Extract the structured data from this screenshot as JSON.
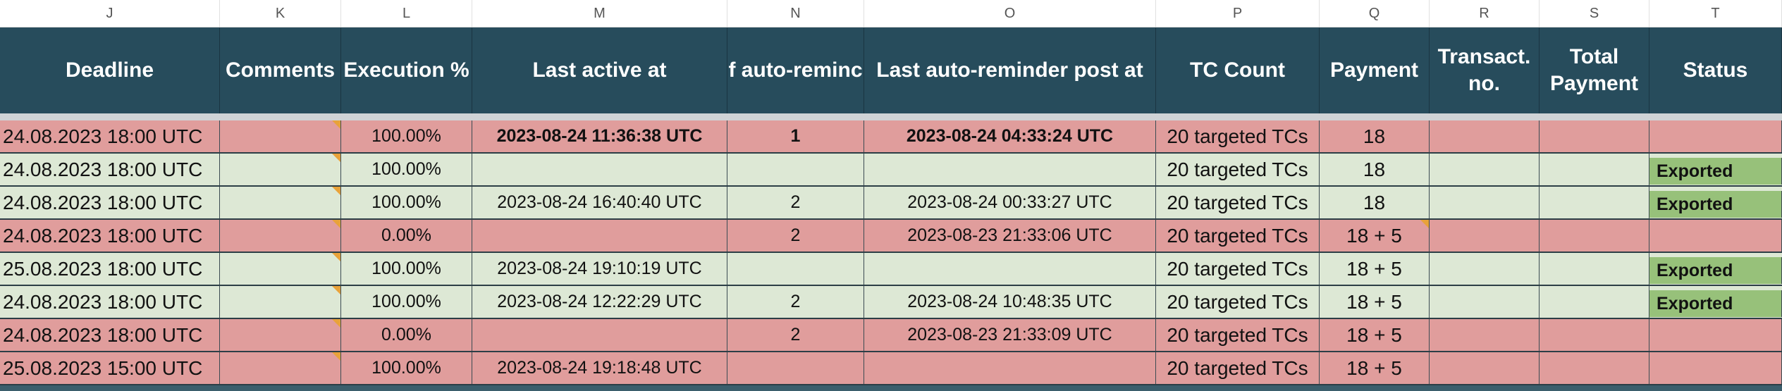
{
  "column_letters": [
    "J",
    "K",
    "L",
    "M",
    "N",
    "O",
    "P",
    "Q",
    "R",
    "S",
    "T"
  ],
  "headers": [
    "Deadline",
    "Comments",
    "Execution %",
    "Last active at",
    "f auto-reminc",
    "Last auto-reminder post at",
    "TC Count",
    "Payment",
    "Transact. no.",
    "Total Payment",
    "Status"
  ],
  "rows": [
    {
      "color": "red",
      "deadline": "24.08.2023 18:00 UTC",
      "comments": "",
      "execution": "100.00%",
      "last_active": "2023-08-24 11:36:38 UTC",
      "reminders": "1",
      "last_reminder": "2023-08-24 04:33:24 UTC",
      "tc_count": "20 targeted TCs",
      "payment": "18",
      "transact_no": "",
      "total_payment": "",
      "status": ""
    },
    {
      "color": "green",
      "deadline": "24.08.2023 18:00 UTC",
      "comments": "",
      "execution": "100.00%",
      "last_active": "",
      "reminders": "",
      "last_reminder": "",
      "tc_count": "20 targeted TCs",
      "payment": "18",
      "transact_no": "",
      "total_payment": "",
      "status": "Exported"
    },
    {
      "color": "green",
      "deadline": "24.08.2023 18:00 UTC",
      "comments": "",
      "execution": "100.00%",
      "last_active": "2023-08-24 16:40:40 UTC",
      "reminders": "2",
      "last_reminder": "2023-08-24 00:33:27 UTC",
      "tc_count": "20 targeted TCs",
      "payment": "18",
      "transact_no": "",
      "total_payment": "",
      "status": "Exported"
    },
    {
      "color": "red",
      "deadline": "24.08.2023 18:00 UTC",
      "comments": "",
      "execution": "0.00%",
      "last_active": "",
      "reminders": "2",
      "last_reminder": "2023-08-23 21:33:06 UTC",
      "tc_count": "20 targeted TCs",
      "payment": "18 + 5",
      "transact_no": "",
      "total_payment": "",
      "status": ""
    },
    {
      "color": "green",
      "deadline": "25.08.2023 18:00 UTC",
      "comments": "",
      "execution": "100.00%",
      "last_active": "2023-08-24 19:10:19 UTC",
      "reminders": "",
      "last_reminder": "",
      "tc_count": "20 targeted TCs",
      "payment": "18 + 5",
      "transact_no": "",
      "total_payment": "",
      "status": "Exported"
    },
    {
      "color": "green",
      "deadline": "24.08.2023 18:00 UTC",
      "comments": "",
      "execution": "100.00%",
      "last_active": "2023-08-24 12:22:29 UTC",
      "reminders": "2",
      "last_reminder": "2023-08-24 10:48:35 UTC",
      "tc_count": "20 targeted TCs",
      "payment": "18 + 5",
      "transact_no": "",
      "total_payment": "",
      "status": "Exported"
    },
    {
      "color": "red",
      "deadline": "24.08.2023 18:00 UTC",
      "comments": "",
      "execution": "0.00%",
      "last_active": "",
      "reminders": "2",
      "last_reminder": "2023-08-23 21:33:09 UTC",
      "tc_count": "20 targeted TCs",
      "payment": "18 + 5",
      "transact_no": "",
      "total_payment": "",
      "status": ""
    },
    {
      "color": "red",
      "deadline": "25.08.2023 15:00 UTC",
      "comments": "",
      "execution": "100.00%",
      "last_active": "2023-08-24 19:18:48 UTC",
      "reminders": "",
      "last_reminder": "",
      "tc_count": "20 targeted TCs",
      "payment": "18 + 5",
      "transact_no": "",
      "total_payment": "",
      "status": ""
    }
  ],
  "colors": {
    "header_bg": "#274c5c",
    "row_red": "#e09d9c",
    "row_green": "#dde8d5",
    "status_exported": "#97c17a",
    "comment_marker": "#e8a23a"
  }
}
